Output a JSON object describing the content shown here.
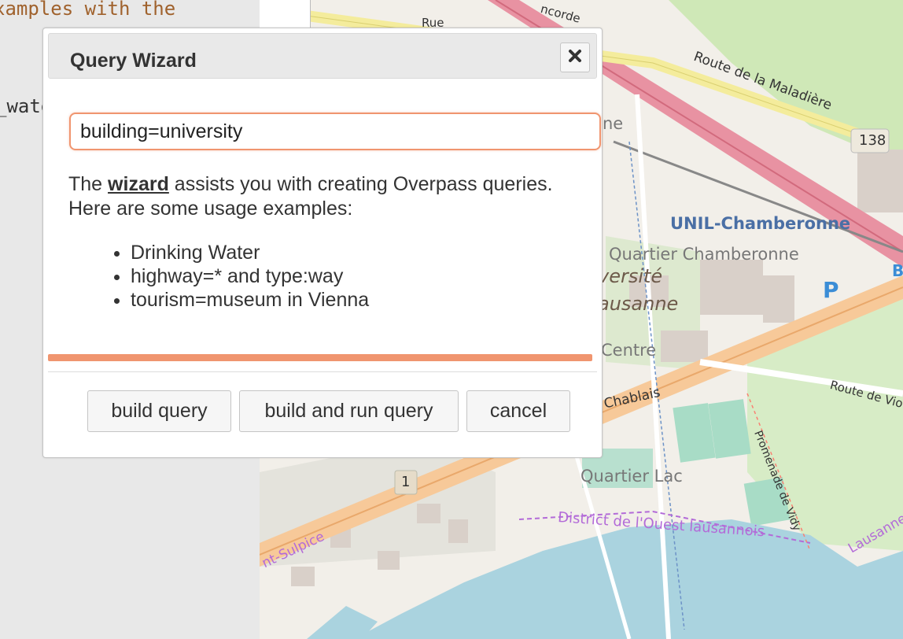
{
  "editor": {
    "line1": "xamples with the",
    "line2": "_wate"
  },
  "map": {
    "labels": {
      "unil": "UNIL-Chamberonne",
      "quartier_chamberonne": "Quartier Chamberonne",
      "universite": "versité",
      "lausanne": "ausanne",
      "centre": "Centre",
      "quartier_lac": "Quartier Lac",
      "district": "District de l'Ouest lausannois",
      "route_maladiere": "Route de la Maladière",
      "route_vio": "Route de Vio",
      "chablais": "Chablais",
      "promenade": "Promenade de Vidy",
      "st_sulpice": "nt-Sulpice",
      "lausanne_edge": "Lausanne",
      "rue": "Rue",
      "concorde": "ncorde",
      "ne": "ne",
      "route_138": "138",
      "route_1": "1",
      "parking": "P",
      "b_edge": "B"
    }
  },
  "dialog": {
    "title": "Query Wizard",
    "query_value": "building=university",
    "desc_prefix": "The",
    "desc_link": "wizard",
    "desc_suffix": "assists you with creating Overpass queries.",
    "desc_line2": "Here are some usage examples:",
    "examples": [
      "Drinking Water",
      "highway=* and type:way",
      "tourism=museum in Vienna"
    ],
    "buttons": {
      "build": "build query",
      "build_run": "build and run query",
      "cancel": "cancel"
    },
    "close_icon": "close-icon",
    "accent_color": "#f0956f"
  }
}
